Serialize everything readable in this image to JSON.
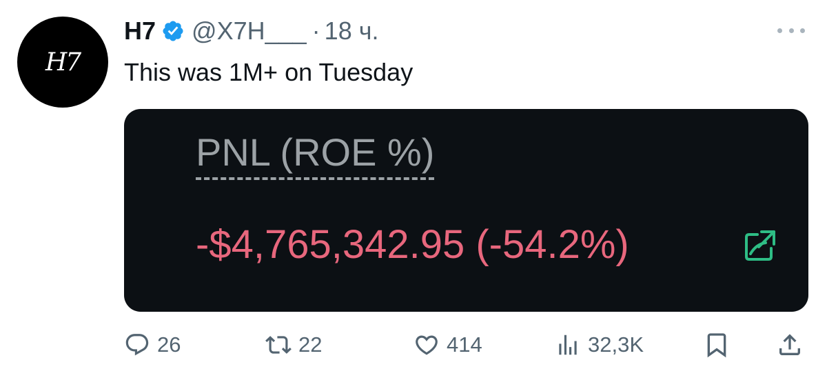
{
  "tweet": {
    "avatar_text": "H7",
    "display_name": "H7",
    "verified_icon": "verified-badge-icon",
    "handle": "@X7H___",
    "dot": "·",
    "time": "18 ч.",
    "more_icon": "more-options-icon",
    "text": "This was 1M+ on Tuesday"
  },
  "card": {
    "label": "PNL (ROE %)",
    "value": "-$4,765,342.95 (-54.2%)",
    "share_icon": "share-external-icon"
  },
  "actions": {
    "replies": "26",
    "reposts": "22",
    "likes": "414",
    "views": "32,3K"
  },
  "colors": {
    "verified": "#1d9bf0",
    "card_background": "#0c1014",
    "pnl_negative": "#e8677d",
    "label_gray": "#9ca2a6",
    "share_icon": "#2ebd85",
    "muted_text": "#536471"
  }
}
